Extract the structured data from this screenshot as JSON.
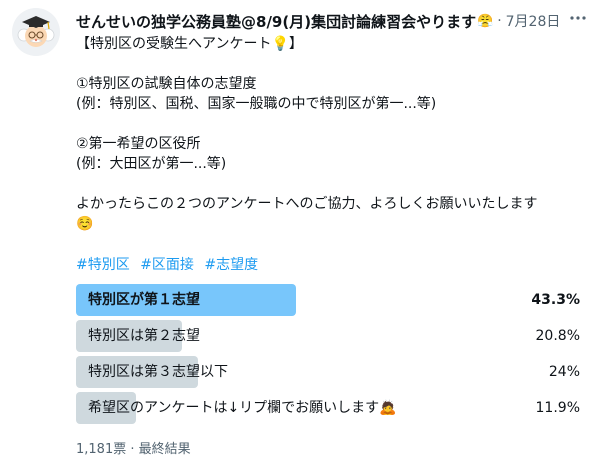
{
  "author": {
    "display_name": "せんせいの独学公務員塾@8/9(月)集団討論練習会やります",
    "name_emoji": "😤",
    "separator": "·",
    "date": "7月28日"
  },
  "tweet": {
    "title_line": "【特別区の受験生へアンケート💡】",
    "q1_line": "①特別区の試験自体の志望度",
    "q1_example": "(例：特別区、国税、国家一般職の中で特別区が第一...等)",
    "q2_line": "②第一希望の区役所",
    "q2_example": "(例：大田区が第一...等)",
    "request_line": "よかったらこの２つのアンケートへのご協力、よろしくお願いいたします",
    "request_emoji": "☺️"
  },
  "hashtags": [
    "#特別区",
    "#区面接",
    "#志望度"
  ],
  "poll": {
    "options": [
      {
        "label": "特別区が第１志望",
        "percent_text": "43.3%",
        "percent": 43.3,
        "winner": true
      },
      {
        "label": "特別区は第２志望",
        "percent_text": "20.8%",
        "percent": 20.8,
        "winner": false
      },
      {
        "label": "特別区は第３志望以下",
        "percent_text": "24%",
        "percent": 24,
        "winner": false
      },
      {
        "label": "希望区のアンケートは↓リプ欄でお願いします🙇",
        "percent_text": "11.9%",
        "percent": 11.9,
        "winner": false
      }
    ],
    "footer": "1,181票 · 最終結果"
  },
  "colors": {
    "winner_bar": "#78c6fb",
    "other_bar": "#cfd9de",
    "link": "#1d9bf0",
    "muted": "#536471"
  },
  "icons": {
    "avatar": "professor-avatar",
    "more": "more-dots-icon"
  }
}
